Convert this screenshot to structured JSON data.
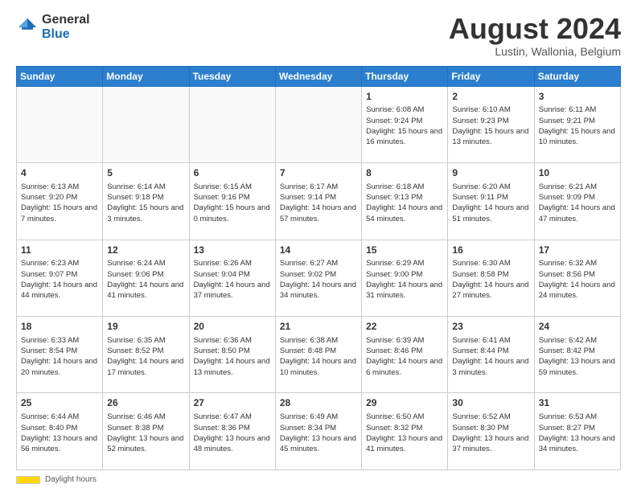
{
  "header": {
    "logo_general": "General",
    "logo_blue": "Blue",
    "month_year": "August 2024",
    "location": "Lustin, Wallonia, Belgium"
  },
  "days_of_week": [
    "Sunday",
    "Monday",
    "Tuesday",
    "Wednesday",
    "Thursday",
    "Friday",
    "Saturday"
  ],
  "weeks": [
    [
      {
        "day": "",
        "empty": true
      },
      {
        "day": "",
        "empty": true
      },
      {
        "day": "",
        "empty": true
      },
      {
        "day": "",
        "empty": true
      },
      {
        "day": "1",
        "sunrise": "6:08 AM",
        "sunset": "9:24 PM",
        "daylight": "15 hours and 16 minutes."
      },
      {
        "day": "2",
        "sunrise": "6:10 AM",
        "sunset": "9:23 PM",
        "daylight": "15 hours and 13 minutes."
      },
      {
        "day": "3",
        "sunrise": "6:11 AM",
        "sunset": "9:21 PM",
        "daylight": "15 hours and 10 minutes."
      }
    ],
    [
      {
        "day": "4",
        "sunrise": "6:13 AM",
        "sunset": "9:20 PM",
        "daylight": "15 hours and 7 minutes."
      },
      {
        "day": "5",
        "sunrise": "6:14 AM",
        "sunset": "9:18 PM",
        "daylight": "15 hours and 3 minutes."
      },
      {
        "day": "6",
        "sunrise": "6:15 AM",
        "sunset": "9:16 PM",
        "daylight": "15 hours and 0 minutes."
      },
      {
        "day": "7",
        "sunrise": "6:17 AM",
        "sunset": "9:14 PM",
        "daylight": "14 hours and 57 minutes."
      },
      {
        "day": "8",
        "sunrise": "6:18 AM",
        "sunset": "9:13 PM",
        "daylight": "14 hours and 54 minutes."
      },
      {
        "day": "9",
        "sunrise": "6:20 AM",
        "sunset": "9:11 PM",
        "daylight": "14 hours and 51 minutes."
      },
      {
        "day": "10",
        "sunrise": "6:21 AM",
        "sunset": "9:09 PM",
        "daylight": "14 hours and 47 minutes."
      }
    ],
    [
      {
        "day": "11",
        "sunrise": "6:23 AM",
        "sunset": "9:07 PM",
        "daylight": "14 hours and 44 minutes."
      },
      {
        "day": "12",
        "sunrise": "6:24 AM",
        "sunset": "9:06 PM",
        "daylight": "14 hours and 41 minutes."
      },
      {
        "day": "13",
        "sunrise": "6:26 AM",
        "sunset": "9:04 PM",
        "daylight": "14 hours and 37 minutes."
      },
      {
        "day": "14",
        "sunrise": "6:27 AM",
        "sunset": "9:02 PM",
        "daylight": "14 hours and 34 minutes."
      },
      {
        "day": "15",
        "sunrise": "6:29 AM",
        "sunset": "9:00 PM",
        "daylight": "14 hours and 31 minutes."
      },
      {
        "day": "16",
        "sunrise": "6:30 AM",
        "sunset": "8:58 PM",
        "daylight": "14 hours and 27 minutes."
      },
      {
        "day": "17",
        "sunrise": "6:32 AM",
        "sunset": "8:56 PM",
        "daylight": "14 hours and 24 minutes."
      }
    ],
    [
      {
        "day": "18",
        "sunrise": "6:33 AM",
        "sunset": "8:54 PM",
        "daylight": "14 hours and 20 minutes."
      },
      {
        "day": "19",
        "sunrise": "6:35 AM",
        "sunset": "8:52 PM",
        "daylight": "14 hours and 17 minutes."
      },
      {
        "day": "20",
        "sunrise": "6:36 AM",
        "sunset": "8:50 PM",
        "daylight": "14 hours and 13 minutes."
      },
      {
        "day": "21",
        "sunrise": "6:38 AM",
        "sunset": "8:48 PM",
        "daylight": "14 hours and 10 minutes."
      },
      {
        "day": "22",
        "sunrise": "6:39 AM",
        "sunset": "8:46 PM",
        "daylight": "14 hours and 6 minutes."
      },
      {
        "day": "23",
        "sunrise": "6:41 AM",
        "sunset": "8:44 PM",
        "daylight": "14 hours and 3 minutes."
      },
      {
        "day": "24",
        "sunrise": "6:42 AM",
        "sunset": "8:42 PM",
        "daylight": "13 hours and 59 minutes."
      }
    ],
    [
      {
        "day": "25",
        "sunrise": "6:44 AM",
        "sunset": "8:40 PM",
        "daylight": "13 hours and 56 minutes."
      },
      {
        "day": "26",
        "sunrise": "6:46 AM",
        "sunset": "8:38 PM",
        "daylight": "13 hours and 52 minutes."
      },
      {
        "day": "27",
        "sunrise": "6:47 AM",
        "sunset": "8:36 PM",
        "daylight": "13 hours and 48 minutes."
      },
      {
        "day": "28",
        "sunrise": "6:49 AM",
        "sunset": "8:34 PM",
        "daylight": "13 hours and 45 minutes."
      },
      {
        "day": "29",
        "sunrise": "6:50 AM",
        "sunset": "8:32 PM",
        "daylight": "13 hours and 41 minutes."
      },
      {
        "day": "30",
        "sunrise": "6:52 AM",
        "sunset": "8:30 PM",
        "daylight": "13 hours and 37 minutes."
      },
      {
        "day": "31",
        "sunrise": "6:53 AM",
        "sunset": "8:27 PM",
        "daylight": "13 hours and 34 minutes."
      }
    ]
  ],
  "footer": {
    "daylight_label": "Daylight hours"
  }
}
